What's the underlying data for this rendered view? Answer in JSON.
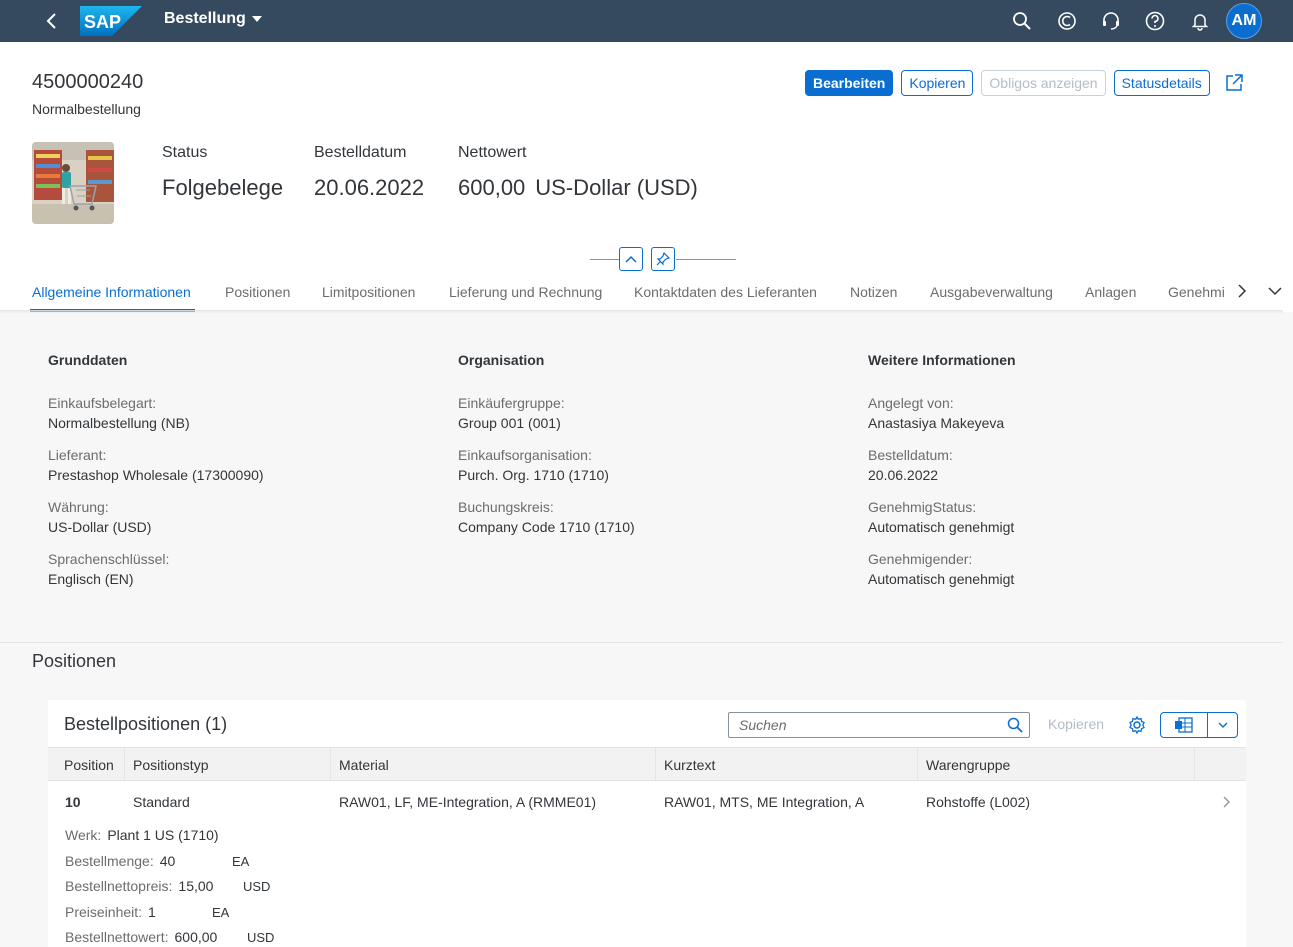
{
  "shell": {
    "logo_text": "SAP",
    "app_title": "Bestellung",
    "avatar_initials": "AM",
    "icons": [
      "back-icon",
      "search-icon",
      "copilot-icon",
      "headset-icon",
      "help-icon",
      "notification-bell-icon"
    ]
  },
  "header": {
    "doc_number": "4500000240",
    "doc_type": "Normalbestellung",
    "actions": {
      "edit": "Bearbeiten",
      "copy": "Kopieren",
      "commitments": "Obligos anzeigen",
      "status_details": "Statusdetails"
    },
    "kpis": [
      {
        "label": "Status",
        "value": "Folgebelege"
      },
      {
        "label": "Bestelldatum",
        "value": "20.06.2022"
      },
      {
        "label": "Nettowert",
        "value": "600,00",
        "unit": "US-Dollar (USD)"
      }
    ],
    "tabs": [
      "Allgemeine Informationen",
      "Positionen",
      "Limitpositionen",
      "Lieferung und Rechnung",
      "Kontaktdaten des Lieferanten",
      "Notizen",
      "Ausgabeverwaltung",
      "Anlagen",
      "Genehmi"
    ],
    "active_tab": "Allgemeine Informationen"
  },
  "general_info": {
    "columns": [
      {
        "title": "Grunddaten",
        "fields": [
          {
            "label": "Einkaufsbelegart:",
            "value": "Normalbestellung (NB)"
          },
          {
            "label": "Lieferant:",
            "value": "Prestashop Wholesale (17300090)"
          },
          {
            "label": "Währung:",
            "value": "US-Dollar (USD)"
          },
          {
            "label": "Sprachenschlüssel:",
            "value": "Englisch (EN)"
          }
        ]
      },
      {
        "title": "Organisation",
        "fields": [
          {
            "label": "Einkäufergruppe:",
            "value": "Group 001 (001)"
          },
          {
            "label": "Einkaufsorganisation:",
            "value": "Purch. Org. 1710 (1710)"
          },
          {
            "label": "Buchungskreis:",
            "value": "Company Code 1710 (1710)"
          }
        ]
      },
      {
        "title": "Weitere Informationen",
        "fields": [
          {
            "label": "Angelegt von:",
            "value": "Anastasiya Makeyeva"
          },
          {
            "label": "Bestelldatum:",
            "value": "20.06.2022"
          },
          {
            "label": "GenehmigStatus:",
            "value": "Automatisch genehmigt"
          },
          {
            "label": "Genehmigender:",
            "value": "Automatisch genehmigt"
          }
        ]
      }
    ]
  },
  "positions": {
    "section_title": "Positionen",
    "table_title": "Bestellpositionen (1)",
    "search_placeholder": "Suchen",
    "copy_label": "Kopieren",
    "columns": [
      "Position",
      "Positionstyp",
      "Material",
      "Kurztext",
      "Warengruppe"
    ],
    "rows": [
      {
        "position": "10",
        "type": "Standard",
        "material": "RAW01, LF, ME-Integration, A (RMME01)",
        "short_text": "RAW01, MTS, ME Integration, A",
        "material_group": "Rohstoffe (L002)",
        "details": {
          "plant_label": "Werk:",
          "plant_value": "Plant 1 US (1710)",
          "qty_label": "Bestellmenge:",
          "qty_value": "40",
          "qty_unit": "EA",
          "price_label": "Bestellnettopreis:",
          "price_value": "15,00",
          "price_unit": "USD",
          "price_unit_label": "Preiseinheit:",
          "price_unit_value": "1",
          "price_unit_uom": "EA",
          "net_value_label": "Bestellnettowert:",
          "net_value_value": "600,00",
          "net_value_unit": "USD"
        }
      }
    ]
  },
  "colors": {
    "shell": "#354a5f",
    "accent": "#0a6ed1",
    "text": "#32363a",
    "label": "#6a6d70"
  }
}
